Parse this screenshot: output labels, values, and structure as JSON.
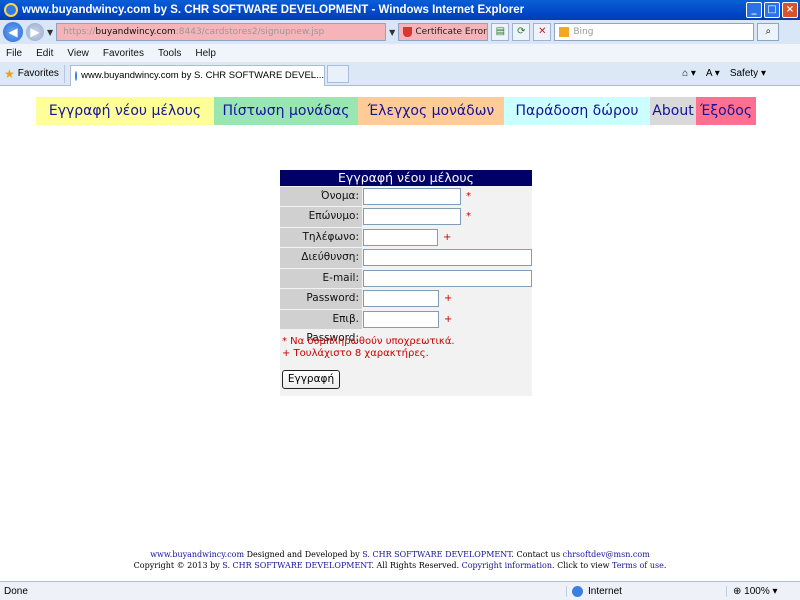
{
  "window": {
    "title": "www.buyandwincy.com by S. CHR SOFTWARE DEVELOPMENT - Windows Internet Explorer",
    "min": "_",
    "max": "□",
    "close": "×"
  },
  "address": {
    "url_prefix": "https://",
    "url_host": "buyandwincy.com",
    "url_rest": ":8443/cardstores2/signupnew.jsp",
    "cert_error": "Certificate Error",
    "search_placeholder": "Bing"
  },
  "menu": [
    "File",
    "Edit",
    "View",
    "Favorites",
    "Tools",
    "Help"
  ],
  "favorites": {
    "label": "Favorites",
    "tab_title": "www.buyandwincy.com by S. CHR SOFTWARE DEVEL...",
    "safety": "Safety"
  },
  "nav": {
    "register": "Εγγραφή νέου μέλους",
    "credit": "Πίστωση μονάδας",
    "check": "Έλεγχος μονάδων",
    "gift": "Παράδοση δώρου",
    "about": "About",
    "exit": "Έξοδος"
  },
  "form": {
    "header": "Εγγραφή νέου μέλους",
    "fields": {
      "firstname": "Όνομα:",
      "lastname": "Επώνυμο:",
      "phone": "Τηλέφωνο:",
      "address": "Διεύθυνση:",
      "email": "E-mail:",
      "password": "Password:",
      "confirm": "Επιβ. Password:"
    },
    "req_star": "*",
    "req_plus": "+",
    "note_required": "* Να συμπληρωθούν υποχρεωτικά.",
    "note_min": "+ Τουλάχιστο 8 χαρακτήρες.",
    "submit": "Εγγραφή"
  },
  "footer": {
    "site": "www.buyandwincy.com",
    "designed": " Designed and Developed by ",
    "company": "S. CHR SOFTWARE DEVELOPMENT",
    "contact": ". Contact us ",
    "email": "chrsoftdev@msn.com",
    "copyright": "Copyright © 2013 by ",
    "company2": "S. CHR SOFTWARE DEVELOPMENT",
    "rights": ". All Rights Reserved. ",
    "copyinfo": "Copyright information",
    "terms_pre": ". Click to view ",
    "terms": "Terms of use",
    "end": "."
  },
  "status": {
    "done": "Done",
    "zone": "Internet",
    "zoom": "100%"
  }
}
